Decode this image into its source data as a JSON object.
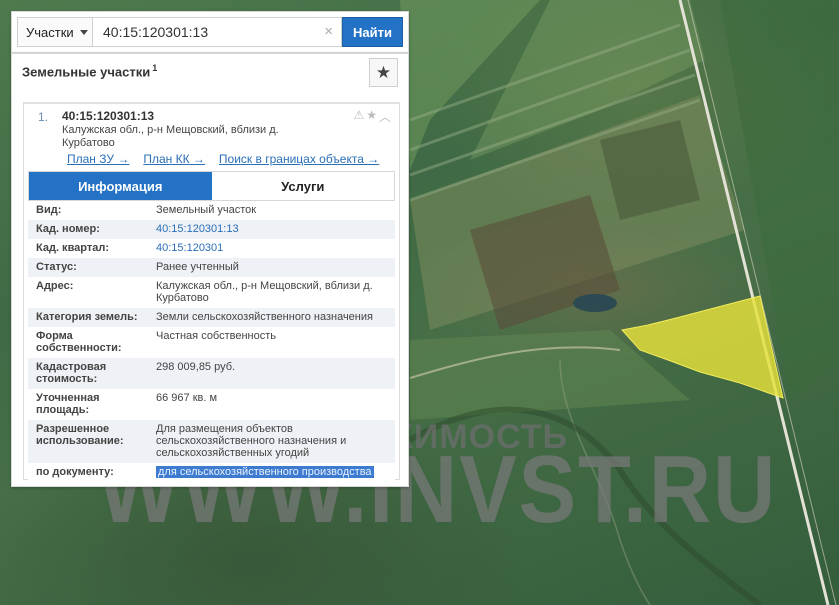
{
  "search": {
    "type_label": "Участки",
    "query": "40:15:120301:13",
    "button_label": "Найти"
  },
  "panel": {
    "title": "Земельные участки",
    "title_sup": "1"
  },
  "result": {
    "index": "1.",
    "number": "40:15:120301:13",
    "address": "Калужская обл., р-н Мещовский, вблизи д. Курбатово",
    "links": [
      "План ЗУ →",
      "План КК →",
      "Поиск в границах объекта →"
    ],
    "tabs": [
      "Информация",
      "Услуги"
    ],
    "rows": [
      {
        "label": "Вид:",
        "value": "Земельный участок"
      },
      {
        "label": "Кад. номер:",
        "value": "40:15:120301:13"
      },
      {
        "label": "Кад. квартал:",
        "value": "40:15:120301"
      },
      {
        "label": "Статус:",
        "value": "Ранее учтенный"
      },
      {
        "label": "Адрес:",
        "value": "Калужская обл., р-н Мещовский, вблизи д. Курбатово"
      },
      {
        "label": "Категория земель:",
        "value": "Земли сельскохозяйственного назначения"
      },
      {
        "label": "Форма собственности:",
        "value": "Частная собственность"
      },
      {
        "label": "Кадастровая стоимость:",
        "value": "298 009,85 руб."
      },
      {
        "label": "Уточненная площадь:",
        "value": "66 967 кв. м"
      },
      {
        "label": "Разрешенное использование:",
        "value": "Для размещения объектов сельскохозяйственного назначения и сельскохозяйственных угодий"
      },
      {
        "label": "по документу:",
        "value": "для сельскохозяйственного производства"
      }
    ]
  },
  "watermark": {
    "top": "ИНВЕСТНЕДВИЖИМОСТЬ",
    "big": "WWW.INVST.RU"
  },
  "colors": {
    "accent": "#2472c5",
    "link": "#2a6fb8",
    "parcel": "#e6e23a"
  }
}
